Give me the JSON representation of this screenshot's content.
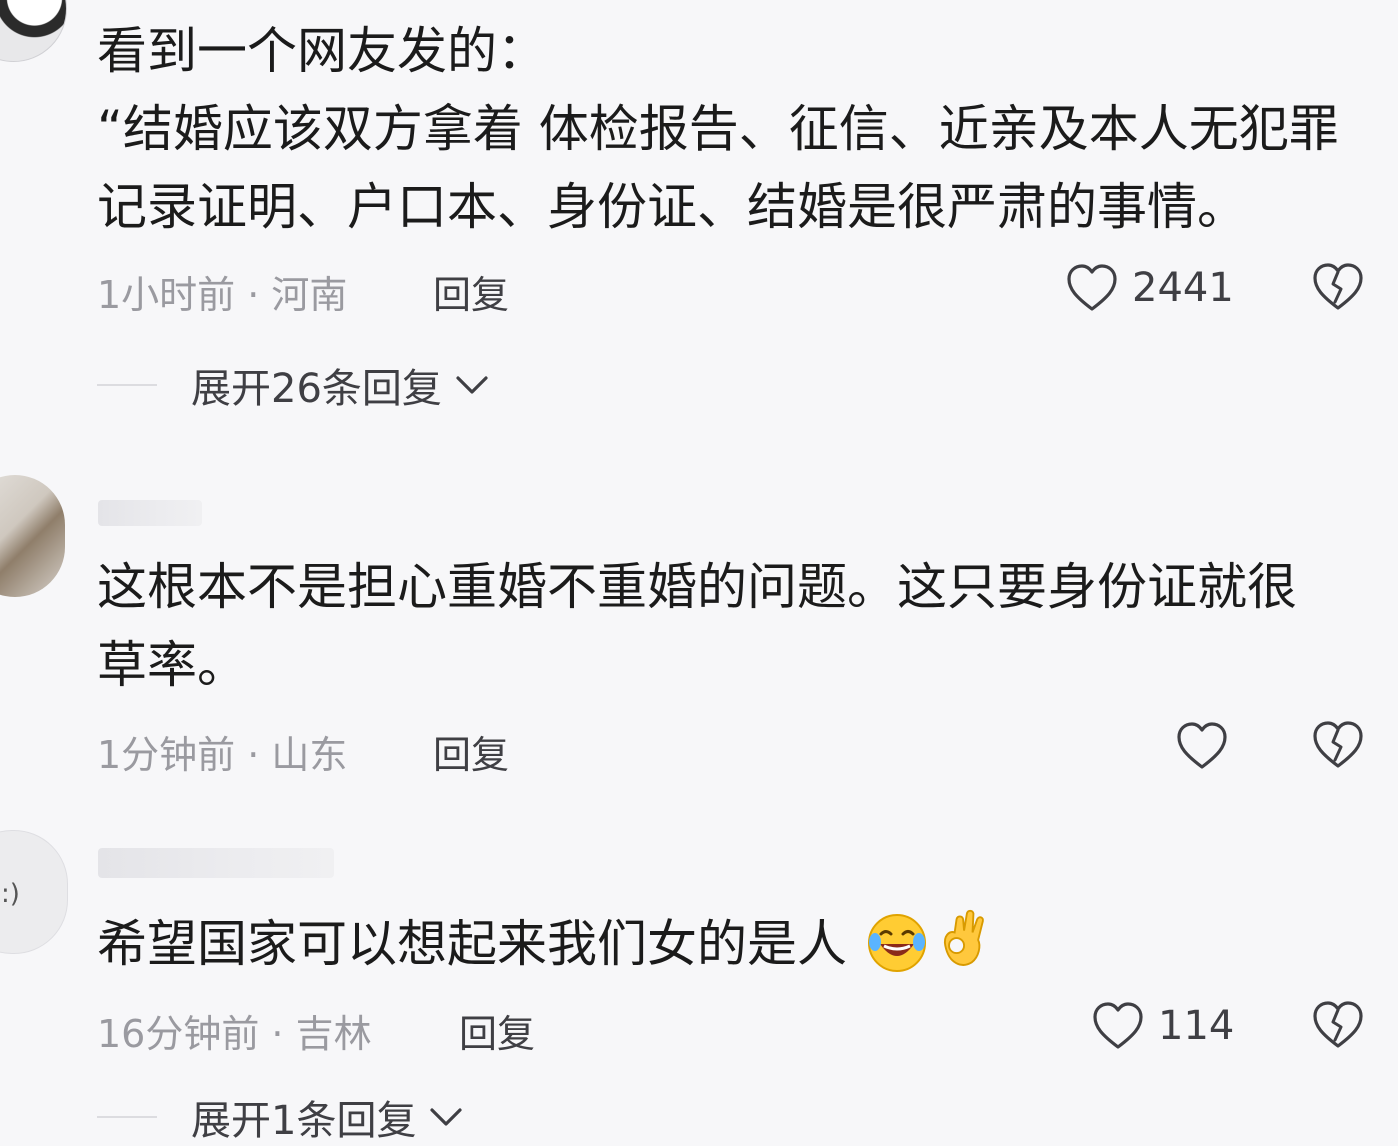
{
  "comments": [
    {
      "lines": [
        "看到一个网友发的：",
        "“结婚应该双方拿着 体检报告、征信、近亲及本人无犯罪",
        "记录证明、户口本、身份证、结婚是很严肃的事情。"
      ],
      "meta": "1小时前 · 河南",
      "reply_label": "回复",
      "likes": "2441",
      "expand_label": "展开26条回复"
    },
    {
      "lines": [
        "这根本不是担心重婚不重婚的问题。这只要身份证就很",
        "草率。"
      ],
      "meta": "1分钟前 · 山东",
      "reply_label": "回复",
      "likes": ""
    },
    {
      "lines": [
        "希望国家可以想起来我们女的是人"
      ],
      "emojis": [
        "laughing-crying-emoji",
        "ok-hand-emoji"
      ],
      "meta": "16分钟前 · 吉林",
      "reply_label": "回复",
      "likes": "114",
      "expand_label": "展开1条回复"
    }
  ],
  "icons": {
    "like": "heart-outline-icon",
    "dislike": "broken-heart-icon",
    "expand": "chevron-down-icon"
  },
  "colors": {
    "background": "#f7f7f9",
    "text": "#1b1b1b",
    "meta": "#9a9aa0",
    "action": "#3f3f44"
  }
}
